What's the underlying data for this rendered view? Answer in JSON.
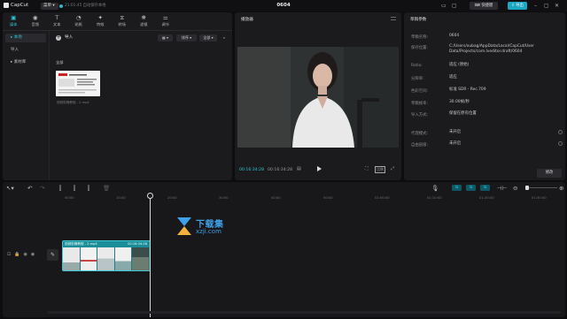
{
  "titlebar": {
    "app_name": "CapCut",
    "menu_label": "菜单",
    "autosave": "21:01:45 自动保存本地",
    "doc_title": "0604",
    "shortcut_label": "快捷键",
    "export_label": "导出"
  },
  "media": {
    "tabs": [
      {
        "label": "媒体",
        "icon": "▣"
      },
      {
        "label": "音频",
        "icon": "◉"
      },
      {
        "label": "文本",
        "icon": "T"
      },
      {
        "label": "贴纸",
        "icon": "◔"
      },
      {
        "label": "特效",
        "icon": "✦"
      },
      {
        "label": "转场",
        "icon": "⧖"
      },
      {
        "label": "滤镜",
        "icon": "❋"
      },
      {
        "label": "调节",
        "icon": "⚌"
      }
    ],
    "sidebar": [
      {
        "label": "▸ 本地"
      },
      {
        "label": "导入"
      },
      {
        "label": "▸ 素材库"
      }
    ],
    "import_label": "导入",
    "sort_label": "排序",
    "filter_label": "全部",
    "folder_label": "全部",
    "file_caption": "视频剪辑教程 - 2.mp4"
  },
  "player": {
    "title": "播放器",
    "time_current": "00:16:34:28",
    "time_total": "00:16:34:28",
    "ratio_label": "比例"
  },
  "details": {
    "title": "草稿参数",
    "rows": [
      {
        "label": "草稿名称:",
        "value": "0604"
      },
      {
        "label": "保存位置:",
        "value": "C:/Users/xubag/AppData/Local/CapCut/User Data/Projects/com.lveditor.draft/0604"
      },
      {
        "label": "Ratio:",
        "value": "适应 (原始)"
      },
      {
        "label": "分辨率:",
        "value": "适应"
      },
      {
        "label": "色彩空间:",
        "value": "标准 SDR - Rec.709"
      },
      {
        "label": "草稿帧率:",
        "value": "30.00帧/秒"
      },
      {
        "label": "导入方式:",
        "value": "保留在原有位置"
      },
      {
        "label": "代理模式:",
        "value": "未开启"
      },
      {
        "label": "自由层级:",
        "value": "未开启"
      }
    ],
    "modify_label": "修改"
  },
  "timeline": {
    "ruler_labels": [
      "00:00",
      "10:00",
      "20:00",
      "30:00",
      "40:00",
      "50:00",
      "01:00:00",
      "01:10:00",
      "01:20:00",
      "01:30:00"
    ],
    "clip_label": "视频剪辑教程 - 2.mp4",
    "clip_duration": "00:16:34:28",
    "watermark_title": "下载集",
    "watermark_sub": "xzji.com"
  },
  "colors": {
    "accent": "#2ec4d6",
    "export": "#1aa7c4",
    "clip": "#1e7e88",
    "watermark": "#3ea0e6"
  }
}
